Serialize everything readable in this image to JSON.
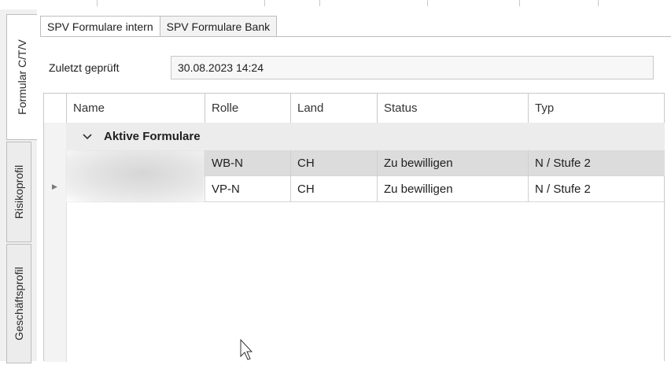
{
  "vertical_tabs": [
    {
      "label": "Formular C/T/V"
    },
    {
      "label": "Risikoprofil"
    },
    {
      "label": "Geschäftsprofil"
    }
  ],
  "tabs": [
    {
      "label": "SPV Formulare intern"
    },
    {
      "label": "SPV Formulare Bank"
    }
  ],
  "last_checked": {
    "label": "Zuletzt geprüft",
    "value": "30.08.2023 14:24"
  },
  "grid": {
    "columns": [
      "Name",
      "Rolle",
      "Land",
      "Status",
      "Typ"
    ],
    "group_label": "Aktive Formulare",
    "rows": [
      {
        "name": "",
        "rolle": "WB-N",
        "land": "CH",
        "status": "Zu bewilligen",
        "typ": "N / Stufe 2"
      },
      {
        "name": "",
        "rolle": "VP-N",
        "land": "CH",
        "status": "Zu bewilligen",
        "typ": "N / Stufe 2"
      }
    ]
  },
  "icons": {
    "group_toggle": "chevron-down-icon",
    "row_indicator": "triangle-right-icon",
    "cursor": "mouse-pointer-icon"
  },
  "colors": {
    "group_background": "#ececec",
    "selected_row": "#dcdcdc",
    "border": "#c8c8c8"
  }
}
